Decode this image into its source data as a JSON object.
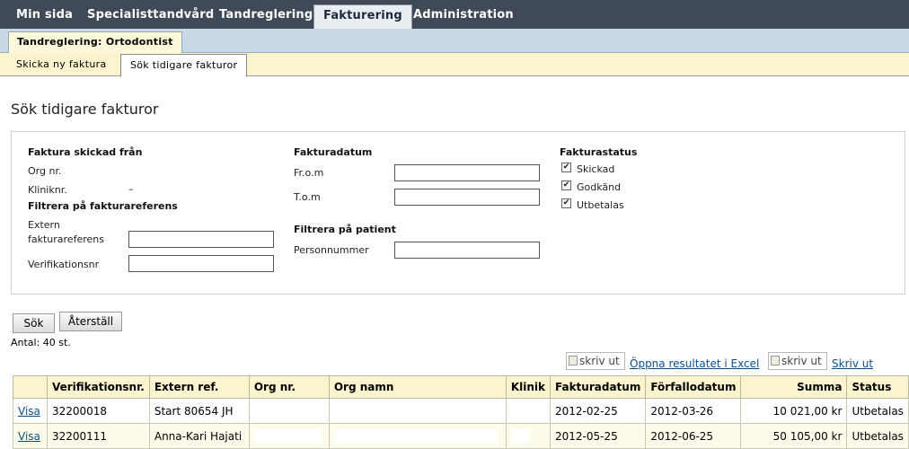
{
  "topnav": {
    "items": [
      "Min sida",
      "Specialisttandvård",
      "Tandreglering",
      "Fakturering",
      "Administration"
    ]
  },
  "subnav": {
    "active_label": "Tandreglering: Ortodontist"
  },
  "tabs": {
    "new_invoice": "Skicka ny faktura",
    "search_invoices": "Sök tidigare fakturor"
  },
  "page": {
    "title": "Sök tidigare fakturor"
  },
  "filters": {
    "sent_from": {
      "heading": "Faktura skickad från",
      "org_nr_label": "Org nr.",
      "org_nr_value": "",
      "clinic_label": "Kliniknr.",
      "clinic_value": "–"
    },
    "invoice_ref": {
      "heading": "Filtrera på fakturareferens",
      "external_label_1": "Extern",
      "external_label_2": "fakturareferens",
      "external_value": "",
      "verification_label": "Verifikationsnr",
      "verification_value": ""
    },
    "invoice_date": {
      "heading": "Fakturadatum",
      "from_label": "Fr.o.m",
      "from_value": "",
      "to_label": "T.o.m",
      "to_value": ""
    },
    "patient": {
      "heading": "Filtrera på patient",
      "personnummer_label": "Personnummer",
      "personnummer_value": ""
    },
    "status": {
      "heading": "Fakturastatus",
      "options": [
        {
          "label": "Skickad",
          "checked": true
        },
        {
          "label": "Godkänd",
          "checked": true
        },
        {
          "label": "Utbetalas",
          "checked": true
        }
      ]
    }
  },
  "actions": {
    "search": "Sök",
    "reset": "Återställ"
  },
  "results": {
    "count": "Antal: 40 st.",
    "print_alt": "skriv ut",
    "excel_link": "Öppna resultatet i Excel",
    "print_link": "Skriv ut",
    "columns": [
      "",
      "Verifikationsnr.",
      "Extern ref.",
      "Org nr.",
      "Org namn",
      "Klinik",
      "Fakturadatum",
      "Förfallodatum",
      "Summa",
      "Status"
    ],
    "rows": [
      {
        "view": "Visa",
        "verif": "32200018",
        "ext_ref": "Start 80654 JH",
        "org_nr": "",
        "org_name": "",
        "clinic": "",
        "invoice_date": "2012-02-25",
        "due_date": "2012-03-26",
        "sum": "10 021,00 kr",
        "status": "Utbetalas"
      },
      {
        "view": "Visa",
        "verif": "32200111",
        "ext_ref": "Anna-Kari Hajati",
        "org_nr": "",
        "org_name": "",
        "clinic": "",
        "invoice_date": "2012-05-25",
        "due_date": "2012-06-25",
        "sum": "50 105,00 kr",
        "status": "Utbetalas"
      }
    ]
  }
}
